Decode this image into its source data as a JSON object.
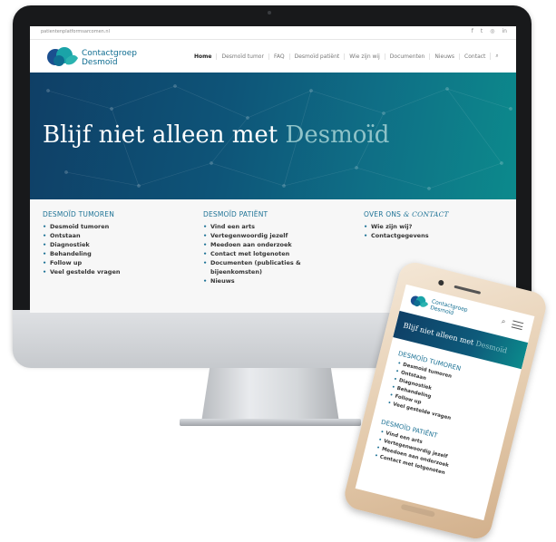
{
  "site": {
    "domain": "patientenplatformsarcomen.nl",
    "social": [
      "f",
      "t",
      "◎",
      "in"
    ],
    "brand_line1": "Contactgroep",
    "brand_line2": "Desmoïd",
    "nav": [
      "Home",
      "Desmoïd tumor",
      "FAQ",
      "Desmoïd patiënt",
      "Wie zijn wij",
      "Documenten",
      "Nieuws",
      "Contact"
    ],
    "hero_title_main": "Blijf niet alleen met ",
    "hero_title_accent": "Desmoïd",
    "columns": [
      {
        "heading_a": "DESMOÏD TUMOREN",
        "heading_b": "",
        "items": [
          "Desmoïd tumoren",
          "Ontstaan",
          "Diagnostiek",
          "Behandeling",
          "Follow up",
          "Veel gestelde vragen"
        ]
      },
      {
        "heading_a": "DESMOÏD PATIËNT",
        "heading_b": "",
        "items": [
          "Vind een arts",
          "Vertegenwoordig jezelf",
          "Meedoen aan onderzoek",
          "Contact met lotgenoten",
          "Documenten (publicaties & bijeenkomsten)",
          "Nieuws"
        ]
      },
      {
        "heading_a": "OVER ONS ",
        "heading_b": "& CONTACT",
        "items": [
          "Wie zijn wij?",
          "Contactgegevens"
        ]
      }
    ]
  },
  "mobile": {
    "brand_line1": "Contactgroep",
    "brand_line2": "Desmoïd",
    "hero_title_main": "Blijf niet alleen met ",
    "hero_title_accent": "Desmoïd",
    "sections": [
      {
        "heading": "DESMOÏD TUMOREN",
        "items": [
          "Desmoïd tumoren",
          "Ontstaan",
          "Diagnostiek",
          "Behandeling",
          "Follow up",
          "Veel gestelde vragen"
        ]
      },
      {
        "heading": "DESMOÏD PATIËNT",
        "items": [
          "Vind een arts",
          "Vertegenwoordig jezelf",
          "Meedoen aan onderzoek",
          "Contact met lotgenoten"
        ]
      }
    ]
  },
  "colors": {
    "brand": "#0f6d91",
    "hero_start": "#0f3f66",
    "hero_end": "#0c8a8c",
    "accent_text": "#8fc3c9"
  },
  "icons": {
    "search": "search-icon",
    "menu": "hamburger-menu-icon",
    "logo": "contactgroep-desmoid-logo"
  }
}
